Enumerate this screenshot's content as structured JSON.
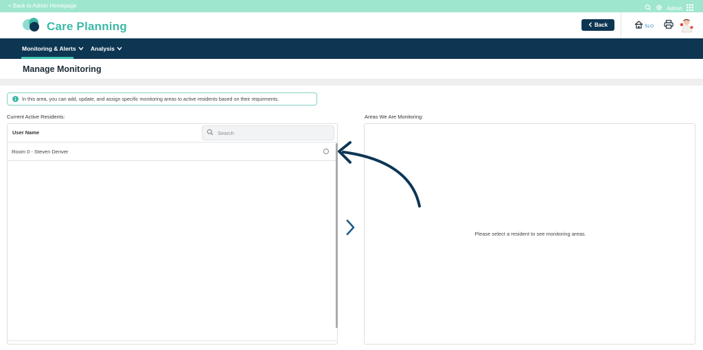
{
  "topbar": {
    "back_link": "< Back to Admin Homepage",
    "user": "Admin"
  },
  "header": {
    "app_title": "Care Planning",
    "back_button": "Back",
    "home_label": "SLO"
  },
  "nav": {
    "items": [
      {
        "label": "Monitoring & Alerts"
      },
      {
        "label": "Analysis"
      }
    ]
  },
  "page": {
    "title": "Manage Monitoring"
  },
  "info": {
    "text": "In this area, you can add, update, and assign specific monitoring areas to active residents based on their requirments."
  },
  "residents": {
    "label": "Current Active Residents:",
    "column_header": "User Name",
    "search_placeholder": "Search",
    "rows": [
      {
        "name": "Room 0 - Steven Denver"
      }
    ]
  },
  "areas": {
    "label": "Areas We Are Monitoring:",
    "empty_message": "Please select a resident to see monitoring areas."
  },
  "colors": {
    "accent": "#3cb9a6",
    "navy": "#0d3653",
    "topbar": "#9fe6cf"
  }
}
